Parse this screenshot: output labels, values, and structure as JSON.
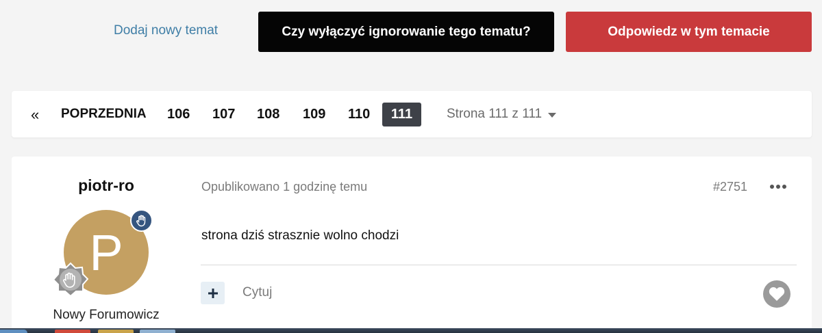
{
  "topbar": {
    "add_topic_label": "Dodaj nowy temat",
    "ignore_label": "Czy wyłączyć ignorowanie tego tematu?",
    "reply_label": "Odpowiedz w tym temacie"
  },
  "pagination": {
    "first_glyph": "«",
    "prev_label": "POPRZEDNIA",
    "pages": [
      "106",
      "107",
      "108",
      "109",
      "110"
    ],
    "current": "111",
    "jump_label": "Strona 111 z 111"
  },
  "post": {
    "author": "piotr-ro",
    "avatar_letter": "P",
    "user_title": "Nowy Forumowicz",
    "meta": "Opublikowano 1 godzinę temu",
    "number": "#2751",
    "body": "strona dziś strasznie wolno chodzi",
    "quote_label": "Cytuj"
  },
  "icons": {
    "first_page": "double-chevron-left-icon",
    "page_jump": "caret-down-icon",
    "badge_hand": "raised-hand-icon",
    "badge_rank": "rank-hand-icon",
    "post_menu": "ellipsis-icon",
    "multiquote": "plus-icon",
    "like": "heart-icon"
  },
  "colors": {
    "reply_button": "#c93a3c",
    "ignore_button": "#050505",
    "link": "#3f7ea6",
    "active_page": "#3e4148",
    "avatar": "#c4a062",
    "badge": "#35557f"
  }
}
